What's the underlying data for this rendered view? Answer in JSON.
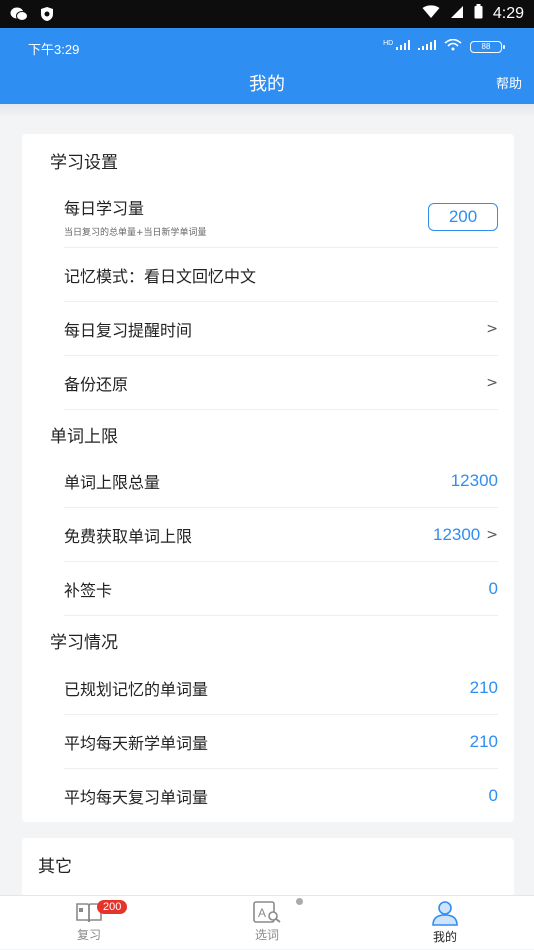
{
  "system_bar": {
    "time": "4:29"
  },
  "inner_status": {
    "time": "下午3:29",
    "battery": "88",
    "network": "HD"
  },
  "header": {
    "title": "我的",
    "help": "帮助"
  },
  "sections": {
    "study_settings": {
      "title": "学习设置",
      "daily_amount": {
        "label": "每日学习量",
        "sub": "当日复习的总单量+当日新学单词量",
        "value": "200"
      },
      "memory_mode": {
        "label": "记忆模式：看日文回忆中文"
      },
      "reminder": {
        "label": "每日复习提醒时间",
        "chevron": ">"
      },
      "backup": {
        "label": "备份还原",
        "chevron": ">"
      }
    },
    "word_limit": {
      "title": "单词上限",
      "total": {
        "label": "单词上限总量",
        "value": "12300"
      },
      "free": {
        "label": "免费获取单词上限",
        "value": "12300",
        "chevron": ">"
      },
      "card": {
        "label": "补签卡",
        "value": "0"
      }
    },
    "study_status": {
      "title": "学习情况",
      "planned": {
        "label": "已规划记忆的单词量",
        "value": "210"
      },
      "avg_new": {
        "label": "平均每天新学单词量",
        "value": "210"
      },
      "avg_review": {
        "label": "平均每天复习单词量",
        "value": "0"
      }
    },
    "other": {
      "title": "其它"
    }
  },
  "tabs": [
    {
      "label": "复习",
      "badge": "200",
      "icon": "book-icon"
    },
    {
      "label": "选词",
      "icon": "dictionary-search-icon"
    },
    {
      "label": "我的",
      "icon": "person-icon"
    }
  ],
  "colors": {
    "primary": "#2f8ef2",
    "badge": "#e8332b"
  }
}
